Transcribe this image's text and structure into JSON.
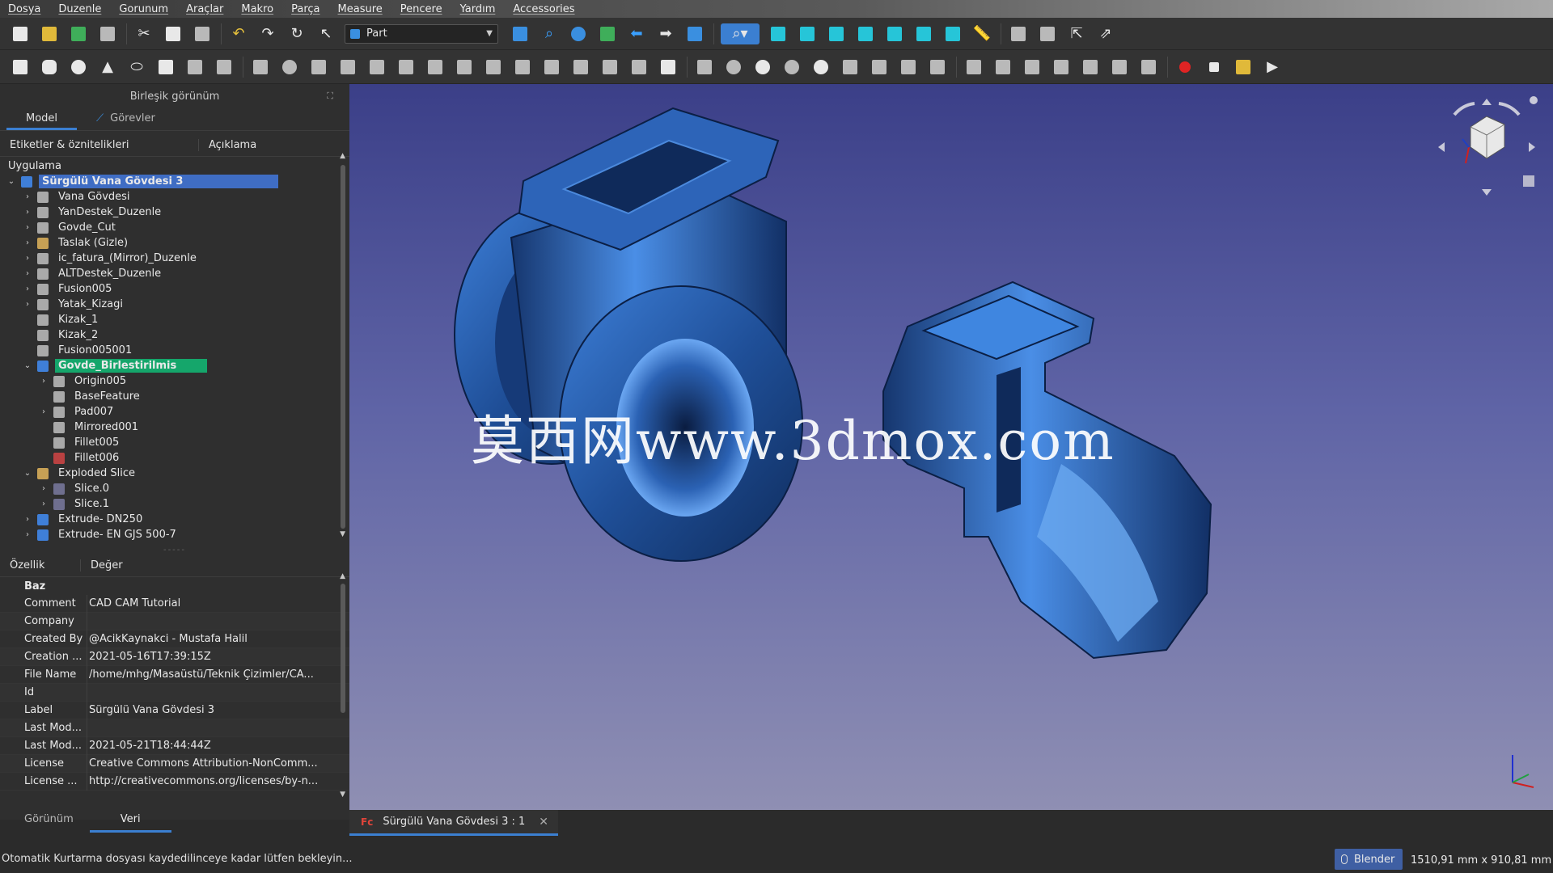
{
  "menu": [
    "Dosya",
    "Duzenle",
    "Gorunum",
    "Araçlar",
    "Makro",
    "Parça",
    "Measure",
    "Pencere",
    "Yardım",
    "Accessories"
  ],
  "toolbar": {
    "workbench": "Part"
  },
  "combo_view": {
    "title": "Birleşik görünüm",
    "tabs": [
      "Model",
      "Görevler"
    ],
    "tree_columns": [
      "Etiketler & öznitelikleri",
      "Açıklama"
    ],
    "tree_section": "Uygulama",
    "tree": [
      {
        "label": "Sürgülü Vana Gövdesi 3",
        "depth": 0,
        "arrow": "down",
        "icon": "body",
        "state": "selected"
      },
      {
        "label": "Vana Gövdesi",
        "depth": 1,
        "arrow": "right",
        "icon": "gray"
      },
      {
        "label": "YanDestek_Duzenle",
        "depth": 1,
        "arrow": "right",
        "icon": "gray"
      },
      {
        "label": "Govde_Cut",
        "depth": 1,
        "arrow": "right",
        "icon": "gray"
      },
      {
        "label": "Taslak (Gizle)",
        "depth": 1,
        "arrow": "right",
        "icon": "folder"
      },
      {
        "label": "ic_fatura_(Mirror)_Duzenle",
        "depth": 1,
        "arrow": "right",
        "icon": "gray"
      },
      {
        "label": "ALTDestek_Duzenle",
        "depth": 1,
        "arrow": "right",
        "icon": "gray"
      },
      {
        "label": "Fusion005",
        "depth": 1,
        "arrow": "right",
        "icon": "gray"
      },
      {
        "label": "Yatak_Kizagi",
        "depth": 1,
        "arrow": "right",
        "icon": "gray"
      },
      {
        "label": "Kizak_1",
        "depth": 1,
        "arrow": "",
        "icon": "gray"
      },
      {
        "label": "Kizak_2",
        "depth": 1,
        "arrow": "",
        "icon": "gray"
      },
      {
        "label": "Fusion005001",
        "depth": 1,
        "arrow": "",
        "icon": "gray"
      },
      {
        "label": "Govde_Birlestirilmis",
        "depth": 1,
        "arrow": "down",
        "icon": "body",
        "state": "active"
      },
      {
        "label": "Origin005",
        "depth": 2,
        "arrow": "right",
        "icon": "gray"
      },
      {
        "label": "BaseFeature",
        "depth": 2,
        "arrow": "",
        "icon": "gray"
      },
      {
        "label": "Pad007",
        "depth": 2,
        "arrow": "right",
        "icon": "gray"
      },
      {
        "label": "Mirrored001",
        "depth": 2,
        "arrow": "",
        "icon": "gray"
      },
      {
        "label": "Fillet005",
        "depth": 2,
        "arrow": "",
        "icon": "gray"
      },
      {
        "label": "Fillet006",
        "depth": 2,
        "arrow": "",
        "icon": "red"
      },
      {
        "label": "Exploded Slice",
        "depth": 1,
        "arrow": "down",
        "icon": "folder"
      },
      {
        "label": "Slice.0",
        "depth": 2,
        "arrow": "right",
        "icon": "slice"
      },
      {
        "label": "Slice.1",
        "depth": 2,
        "arrow": "right",
        "icon": "slice"
      },
      {
        "label": "Extrude- DN250",
        "depth": 1,
        "arrow": "right",
        "icon": "body"
      },
      {
        "label": "Extrude- EN GJS 500-7",
        "depth": 1,
        "arrow": "right",
        "icon": "body"
      }
    ],
    "prop_columns": [
      "Özellik",
      "Değer"
    ],
    "prop_group": "Baz",
    "properties": [
      {
        "key": "Comment",
        "value": "CAD CAM Tutorial"
      },
      {
        "key": "Company",
        "value": ""
      },
      {
        "key": "Created By",
        "value": "@AcikKaynakci - Mustafa Halil"
      },
      {
        "key": "Creation ...",
        "value": "2021-05-16T17:39:15Z"
      },
      {
        "key": "File Name",
        "value": "/home/mhg/Masaüstü/Teknik Çizimler/CA..."
      },
      {
        "key": "Id",
        "value": ""
      },
      {
        "key": "Label",
        "value": "Sürgülü Vana Gövdesi 3"
      },
      {
        "key": "Last Mod...",
        "value": ""
      },
      {
        "key": "Last Mod...",
        "value": "2021-05-21T18:44:44Z"
      },
      {
        "key": "License",
        "value": "Creative Commons Attribution-NonComm..."
      },
      {
        "key": "License ...",
        "value": "http://creativecommons.org/licenses/by-n..."
      }
    ],
    "bottom_tabs": [
      "Görünüm",
      "Veri"
    ]
  },
  "viewport": {
    "watermark": "莫西网www.3dmox.com"
  },
  "document_tab": {
    "title": "Sürgülü Vana Gövdesi 3 : 1",
    "close": "✕"
  },
  "status": {
    "message": "Otomatik Kurtarma dosyası kaydedilinceye kadar lütfen bekleyin...",
    "nav_style": "Blender",
    "dimensions": "1510,91 mm x 910,81 mm"
  },
  "colors": {
    "accent": "#3b7fd1",
    "selection_green": "#15a66b",
    "model_blue": "#2a5fae"
  }
}
